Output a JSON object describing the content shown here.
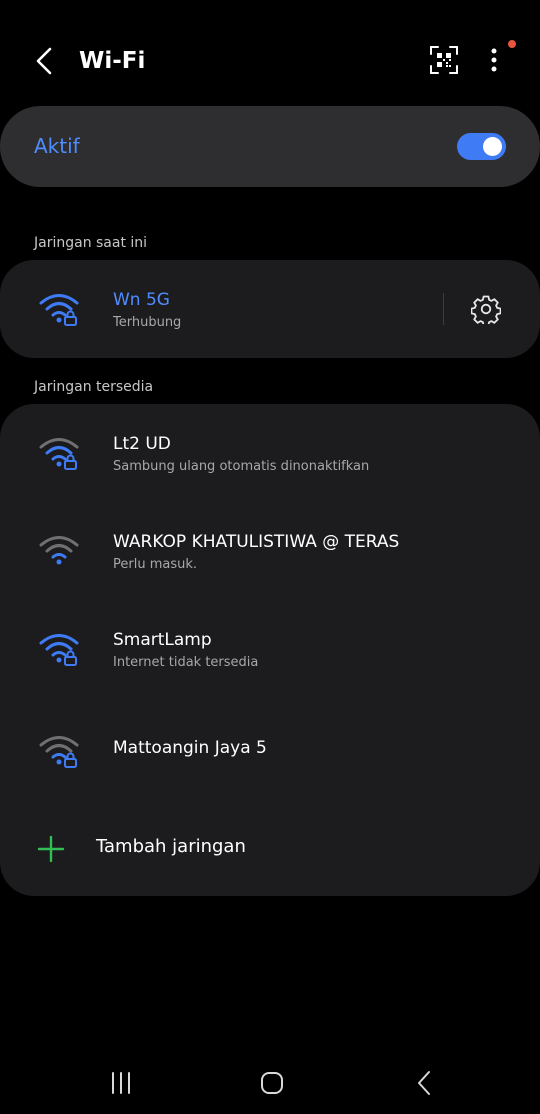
{
  "header": {
    "title": "Wi-Fi",
    "icons": [
      "back-arrow-icon",
      "qr-code-scan-icon",
      "more-vert-icon"
    ],
    "notification_dot_color": "#e8553d"
  },
  "toggle": {
    "label": "Aktif",
    "state": "on",
    "label_color": "#4f8dff",
    "switch_color": "#3e7bf5"
  },
  "current_section": {
    "label": "Jaringan saat ini"
  },
  "current_network": {
    "name": "Wn 5G",
    "status": "Terhubung",
    "name_color": "#4f8dff",
    "icon": "wifi-lock-icon",
    "signal": "full"
  },
  "available_section": {
    "label": "Jaringan tersedia"
  },
  "available_networks": [
    {
      "name": "Lt2 UD",
      "status": "Sambung ulang otomatis dinonaktifkan",
      "icon": "wifi-lock-icon",
      "signal": "medium"
    },
    {
      "name": "WARKOP KHATULISTIWA @ TERAS",
      "status": "Perlu masuk.",
      "icon": "wifi-icon",
      "signal": "low"
    },
    {
      "name": "SmartLamp",
      "status": "Internet tidak tersedia",
      "icon": "wifi-lock-icon",
      "signal": "full"
    },
    {
      "name": "Mattoangin Jaya 5",
      "status": "",
      "icon": "wifi-lock-icon",
      "signal": "low"
    }
  ],
  "add_network": {
    "label": "Tambah jaringan",
    "icon": "plus-icon",
    "icon_color": "#2fbf54"
  },
  "navbar": {
    "icons": [
      "recent-apps-icon",
      "home-icon",
      "back-icon"
    ]
  }
}
